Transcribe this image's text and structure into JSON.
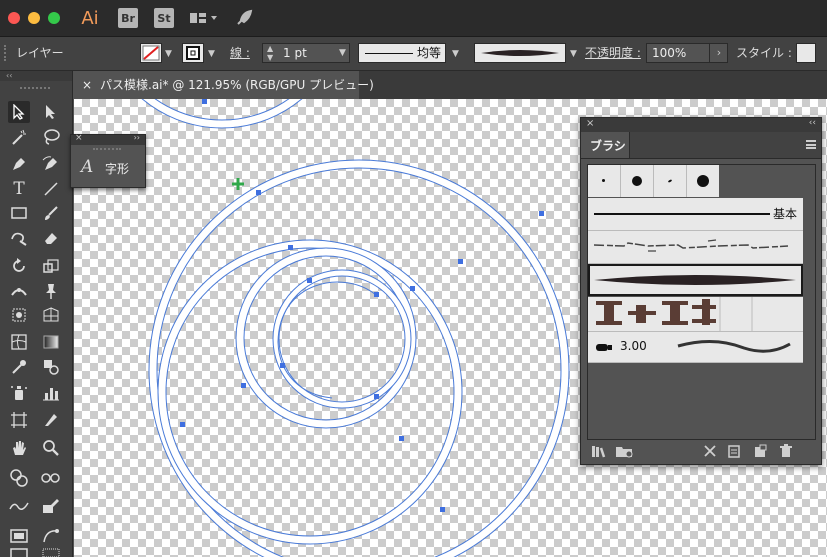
{
  "window": {
    "app_logo": "Ai",
    "apps": [
      "Br",
      "St"
    ],
    "traffic_lights": [
      "#fc5753",
      "#fdbc40",
      "#34c84a"
    ]
  },
  "control_bar": {
    "layer_label": "レイヤー",
    "stroke_label": "線 :",
    "stroke_weight": "1 pt",
    "profile_label": "均等",
    "opacity_label": "不透明度 :",
    "opacity_value": "100%",
    "style_label": "スタイル :"
  },
  "document": {
    "tab_title": "パス模様.ai* @ 121.95% (RGB/GPU プレビュー)",
    "close_glyph": "×"
  },
  "glyph_panel": {
    "glyph_icon": "A",
    "label": "字形"
  },
  "brush_panel": {
    "title": "ブラシ",
    "basic_label": "基本",
    "bristle_size": "3.00"
  },
  "colors": {
    "accent_path": "#4a7bd8",
    "ring_white": "#ffffff",
    "anchor": "#3f6fe0",
    "cursor_green": "#2fa84a"
  },
  "icons": [
    "back-arrow-icon",
    "workspace-grid-icon",
    "rocket-icon"
  ]
}
